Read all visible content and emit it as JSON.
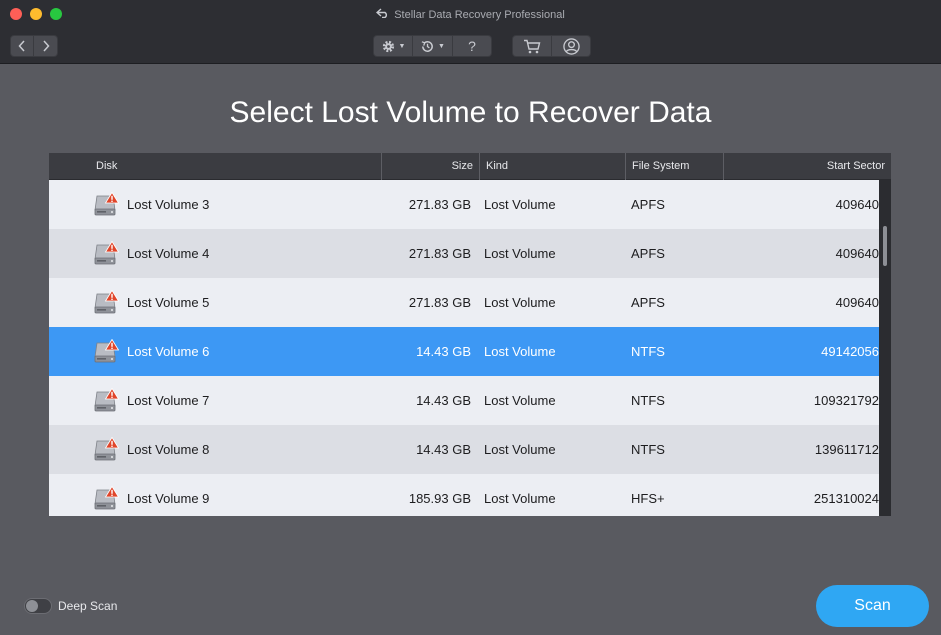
{
  "window": {
    "title": "Stellar Data Recovery Professional"
  },
  "heading": "Select Lost Volume to Recover Data",
  "table": {
    "columns": [
      "Disk",
      "Size",
      "Kind",
      "File System",
      "Start Sector"
    ],
    "rows": [
      {
        "disk": "Lost Volume 3",
        "size": "271.83 GB",
        "kind": "Lost Volume",
        "fs": "APFS",
        "start": "409640"
      },
      {
        "disk": "Lost Volume 4",
        "size": "271.83 GB",
        "kind": "Lost Volume",
        "fs": "APFS",
        "start": "409640"
      },
      {
        "disk": "Lost Volume 5",
        "size": "271.83 GB",
        "kind": "Lost Volume",
        "fs": "APFS",
        "start": "409640"
      },
      {
        "disk": "Lost Volume 6",
        "size": "14.43 GB",
        "kind": "Lost Volume",
        "fs": "NTFS",
        "start": "49142056"
      },
      {
        "disk": "Lost Volume 7",
        "size": "14.43 GB",
        "kind": "Lost Volume",
        "fs": "NTFS",
        "start": "109321792"
      },
      {
        "disk": "Lost Volume 8",
        "size": "14.43 GB",
        "kind": "Lost Volume",
        "fs": "NTFS",
        "start": "139611712"
      },
      {
        "disk": "Lost Volume 9",
        "size": "185.93 GB",
        "kind": "Lost Volume",
        "fs": "HFS+",
        "start": "251310024"
      }
    ],
    "selected_index": 3
  },
  "toolbar": {
    "icons": [
      "chevron-left-icon",
      "chevron-right-icon",
      "gear-icon",
      "history-icon",
      "help-icon",
      "cart-icon",
      "account-icon"
    ],
    "help_label": "?"
  },
  "deep_scan": {
    "label": "Deep Scan",
    "enabled": false
  },
  "scan_button": {
    "label": "Scan"
  },
  "colors": {
    "accent": "#2fa7f3",
    "selected_row": "#3d98f4",
    "warning": "#e0452a"
  }
}
